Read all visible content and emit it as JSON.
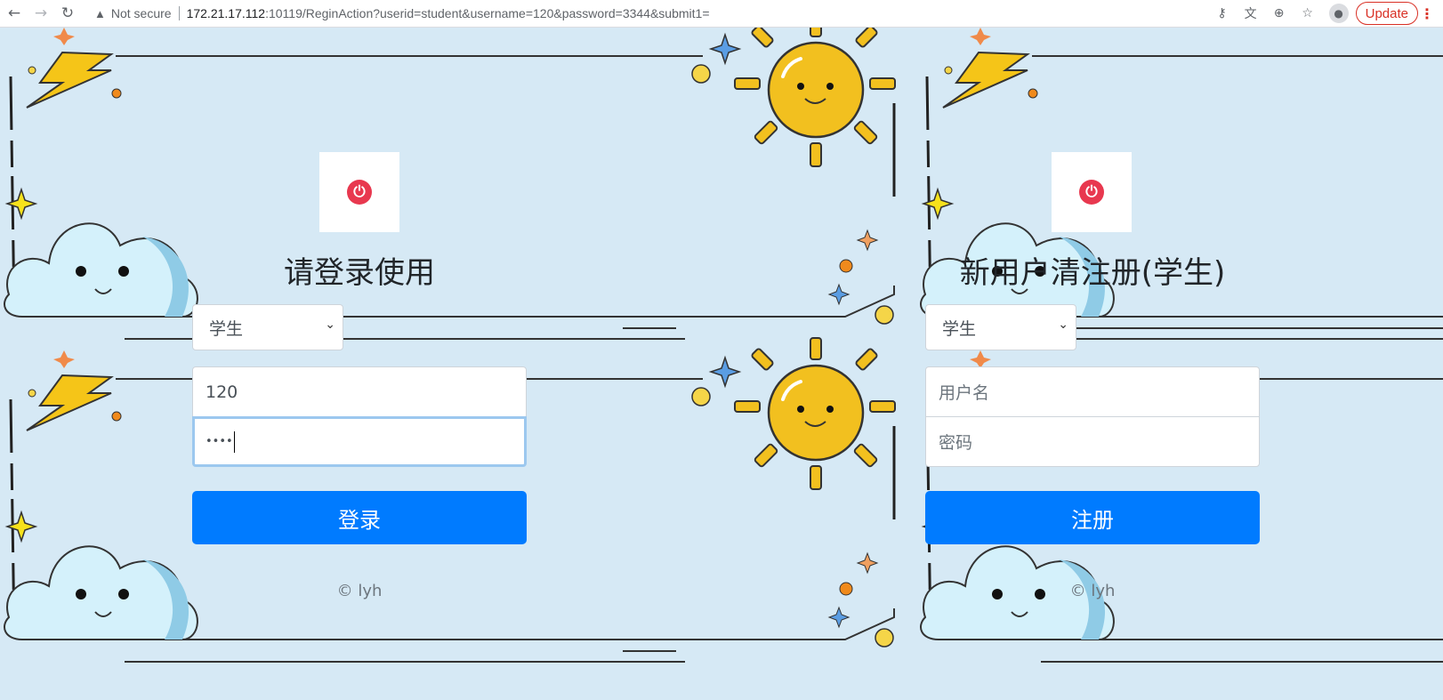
{
  "browser": {
    "warning_text": "Not secure",
    "url_host": "172.21.17.112",
    "url_rest": ":10119/ReginAction?userid=student&username=120&password=3344&submit1=",
    "update_label": "Update"
  },
  "login": {
    "title": "请登录使用",
    "role_select": "学生",
    "username_value": "120",
    "password_value": "••••",
    "submit_label": "登录",
    "footer": "© lyh"
  },
  "register": {
    "title": "新用户清注册(学生)",
    "role_select": "学生",
    "username_placeholder": "用户名",
    "password_placeholder": "密码",
    "submit_label": "注册",
    "footer": "© lyh"
  },
  "colors": {
    "primary": "#007bff",
    "power_icon": "#e8384f",
    "background": "#d6e9f5"
  }
}
